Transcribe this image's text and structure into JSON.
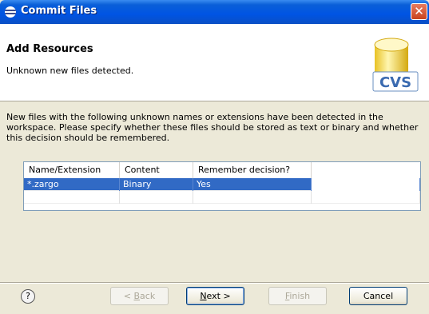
{
  "window": {
    "title": "Commit Files"
  },
  "banner": {
    "heading": "Add Resources",
    "subtext": "Unknown new files detected.",
    "logo_text": "CVS"
  },
  "description": "New files with the following unknown names or extensions have been detected in the workspace. Please specify whether these files should be stored as text or binary and whether this decision should be remembered.",
  "table": {
    "columns": [
      "Name/Extension",
      "Content",
      "Remember decision?"
    ],
    "rows": [
      {
        "name": "*.zargo",
        "content": "Binary",
        "remember": "Yes",
        "selected": true
      }
    ]
  },
  "buttons": {
    "help": "?",
    "back_prefix": "< ",
    "back_mnemonic": "B",
    "back_rest": "ack",
    "next_mnemonic": "N",
    "next_rest": "ext >",
    "finish_mnemonic": "F",
    "finish_rest": "inish",
    "cancel": "Cancel"
  },
  "colors": {
    "titlebar": "#0054e3",
    "selection": "#316ac5",
    "dialog_bg": "#ece9d8"
  }
}
